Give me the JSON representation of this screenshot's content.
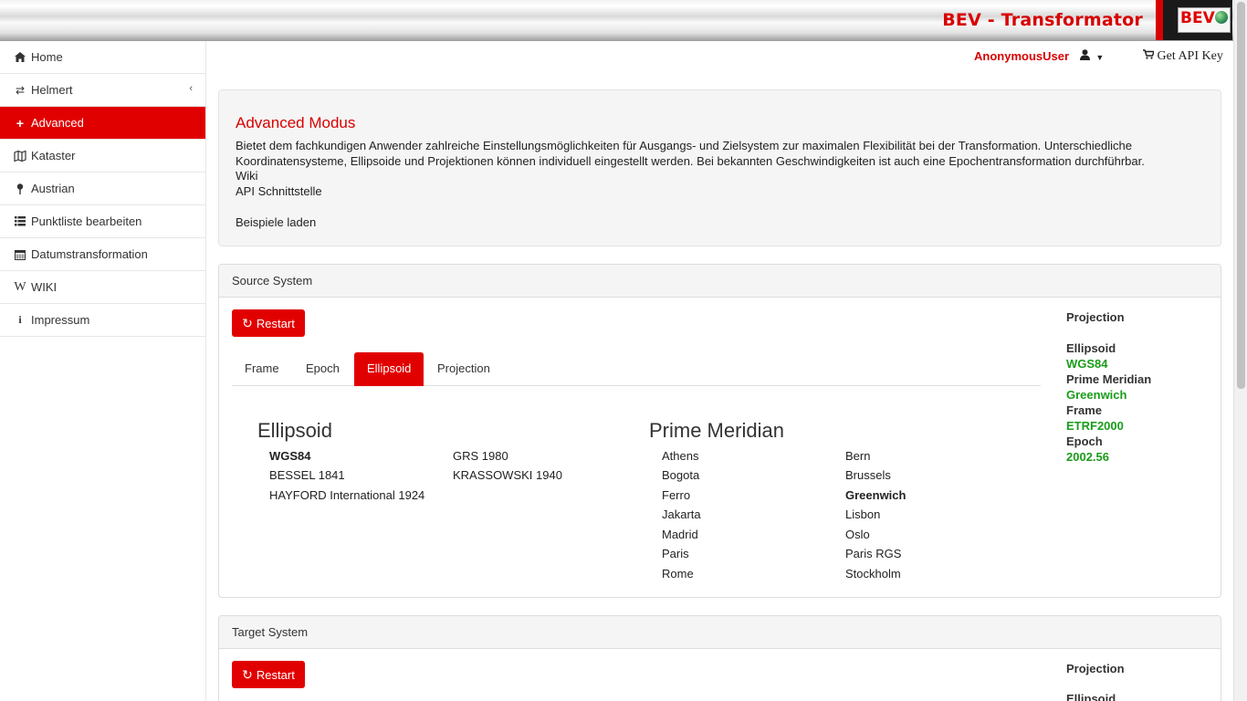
{
  "header": {
    "brand": "BEV - Transformator",
    "logo_text": "BEV"
  },
  "sidebar": {
    "items": [
      {
        "label": "Home",
        "icon": "home-icon"
      },
      {
        "label": "Helmert",
        "icon": "exchange-icon"
      },
      {
        "label": "Advanced",
        "icon": "plus-icon"
      },
      {
        "label": "Kataster",
        "icon": "map-icon"
      },
      {
        "label": "Austrian",
        "icon": "map-pin-icon"
      },
      {
        "label": "Punktliste bearbeiten",
        "icon": "list-icon"
      },
      {
        "label": "Datumstransformation",
        "icon": "calendar-icon"
      },
      {
        "label": "WIKI",
        "icon": "wikipedia-icon"
      },
      {
        "label": "Impressum",
        "icon": "info-icon"
      }
    ]
  },
  "topbar": {
    "user": "AnonymousUser",
    "api_key": "Get API Key"
  },
  "info": {
    "title": "Advanced Modus",
    "description": "Bietet dem fachkundigen Anwender zahlreiche Einstellungsmöglichkeiten für Ausgangs- und Zielsystem zur maximalen Flexibilität bei der Transformation. Unterschiedliche Koordinatensysteme, Ellipsoide und Projektionen können individuell eingestellt werden. Bei bekannten Geschwindigkeiten ist auch eine Epochentransformation durchführbar.",
    "wiki": "Wiki",
    "api": "API Schnittstelle",
    "examples": "Beispiele laden"
  },
  "source": {
    "heading": "Source System",
    "restart": "Restart",
    "tabs": [
      "Frame",
      "Epoch",
      "Ellipsoid",
      "Projection"
    ],
    "ellipsoid_title": "Ellipsoid",
    "ellipsoids": [
      "WGS84",
      "GRS 1980",
      "BESSEL 1841",
      "KRASSOWSKI 1940",
      "HAYFORD International 1924"
    ],
    "meridian_title": "Prime Meridian",
    "meridians": [
      "Athens",
      "Bern",
      "Bogota",
      "Brussels",
      "Ferro",
      "Greenwich",
      "Jakarta",
      "Lisbon",
      "Madrid",
      "Oslo",
      "Paris",
      "Paris RGS",
      "Rome",
      "Stockholm"
    ],
    "summary": {
      "projection_label": "Projection",
      "ellipsoid_label": "Ellipsoid",
      "ellipsoid_value": "WGS84",
      "meridian_label": "Prime Meridian",
      "meridian_value": "Greenwich",
      "frame_label": "Frame",
      "frame_value": "ETRF2000",
      "epoch_label": "Epoch",
      "epoch_value": "2002.56"
    }
  },
  "target": {
    "heading": "Target System",
    "restart": "Restart",
    "summary": {
      "projection_label": "Projection",
      "ellipsoid_label": "Ellipsoid"
    }
  },
  "colors": {
    "accent": "#e10000",
    "brand": "#d80000",
    "value_green": "#1a9c1a"
  }
}
